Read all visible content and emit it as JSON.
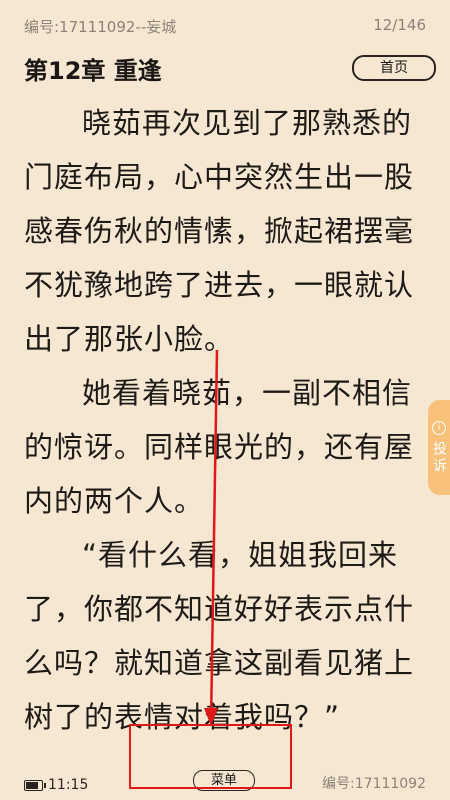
{
  "header": {
    "book_id_title": "编号:17111092--妄城",
    "page_counter": "12/146",
    "chapter_title": "第12章 重逢",
    "home_button": "首页"
  },
  "content": {
    "paragraphs": [
      "晓茹再次见到了那熟悉的门庭布局，心中突然生出一股感春伤秋的情愫，掀起裙摆毫不犹豫地跨了进去，一眼就认出了那张小脸。",
      "她看着晓茹，一副不相信的惊讶。同样眼光的，还有屋内的两个人。",
      "“看什么看，姐姐我回来了，你都不知道好好表示点什么吗？就知道拿这副看见猪上树了的表情对着我吗？”"
    ]
  },
  "side_tab": {
    "icon": "info-circle-icon",
    "label": "投诉",
    "color": "#f7c17a"
  },
  "footer": {
    "battery_icon": "battery-icon",
    "battery_level": 0.8,
    "time": "11:15",
    "menu_button": "菜单",
    "book_id": "编号:17111092"
  },
  "colors": {
    "background": "#f6e7d2",
    "annotation": "#e01818"
  }
}
